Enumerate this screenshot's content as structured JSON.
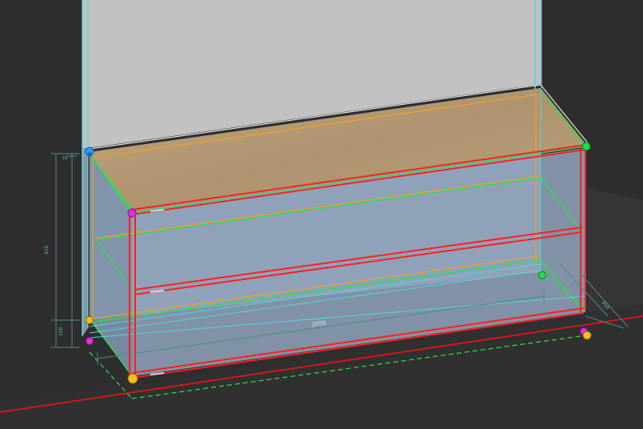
{
  "viewport": {
    "dimensions": {
      "width_label": "2000",
      "height_label": "410",
      "plinth_label": "100",
      "depth_label": "450",
      "top_tick_label": "18"
    },
    "colors": {
      "background": "#2e2e2e",
      "floor": "#383838",
      "back_wall": "#c0c0c0",
      "wall_edge": "#4fd6df",
      "cabinet_glass": "#8a9db6",
      "worktop": "#b49a74",
      "frame_red": "#ff2020",
      "selection_green": "#27e34a",
      "guide_orange": "#f2a020",
      "dimension_line": "#4a8c8c",
      "axis_red": "#e01515",
      "handle_magenta": "#e030e0",
      "handle_yellow": "#f0c020",
      "handle_blue": "#2aa0f0",
      "handle_green": "#22dd44"
    },
    "handles": [
      {
        "name": "handle-top-left-back",
        "color": "blue"
      },
      {
        "name": "handle-top-right",
        "color": "green"
      },
      {
        "name": "handle-top-left-front",
        "color": "magenta"
      },
      {
        "name": "handle-bottom-left-back-yellow",
        "color": "yellow"
      },
      {
        "name": "handle-bottom-left-back-magenta",
        "color": "magenta"
      },
      {
        "name": "handle-bottom-front-left",
        "color": "yellow"
      },
      {
        "name": "handle-bottom-right-magenta",
        "color": "magenta"
      },
      {
        "name": "handle-bottom-right-yellow",
        "color": "yellow"
      },
      {
        "name": "handle-mid-right-back",
        "color": "green"
      }
    ]
  }
}
